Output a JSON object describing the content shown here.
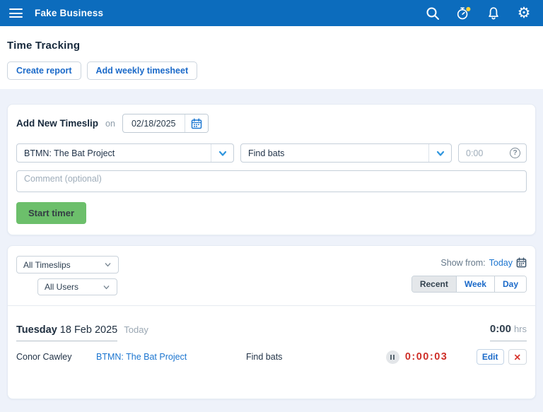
{
  "colors": {
    "topbar_blue": "#0c6cbd",
    "accent_blue": "#1b6ac9",
    "link_blue": "#1b75d0",
    "chevron_blue": "#2e95dd",
    "start_green": "#6cbf6b",
    "timer_red": "#ce2f28",
    "notification_yellow": "#ffd43a"
  },
  "topbar": {
    "business_name": "Fake Business"
  },
  "page_header": {
    "title": "Time Tracking",
    "create_report_label": "Create report",
    "add_weekly_timesheet_label": "Add weekly timesheet"
  },
  "add_timeslip": {
    "title": "Add New Timeslip",
    "on_label": "on",
    "date": "02/18/2025",
    "project": "BTMN: The Bat Project",
    "task": "Find bats",
    "duration_placeholder": "0:00",
    "comment_placeholder": "Comment (optional)",
    "start_timer_label": "Start timer"
  },
  "filters": {
    "timeslips": "All Timeslips",
    "users": "All Users",
    "show_from_label": "Show from:",
    "show_from_value": "Today",
    "tabs": [
      {
        "label": "Recent",
        "active": true
      },
      {
        "label": "Week",
        "active": false
      },
      {
        "label": "Day",
        "active": false
      }
    ]
  },
  "timeslips": {
    "day_header": {
      "weekday": "Tuesday",
      "date": " 18 Feb 2025",
      "badge": "Today",
      "total": "0:00",
      "unit": "hrs"
    },
    "rows": [
      {
        "user": "Conor Cawley",
        "project": "BTMN: The Bat Project",
        "task": "Find bats",
        "timer": "0:00:03",
        "edit_label": "Edit",
        "delete_glyph": "✕"
      }
    ]
  },
  "glyphs": {
    "gear": "⚙",
    "question": "?"
  }
}
